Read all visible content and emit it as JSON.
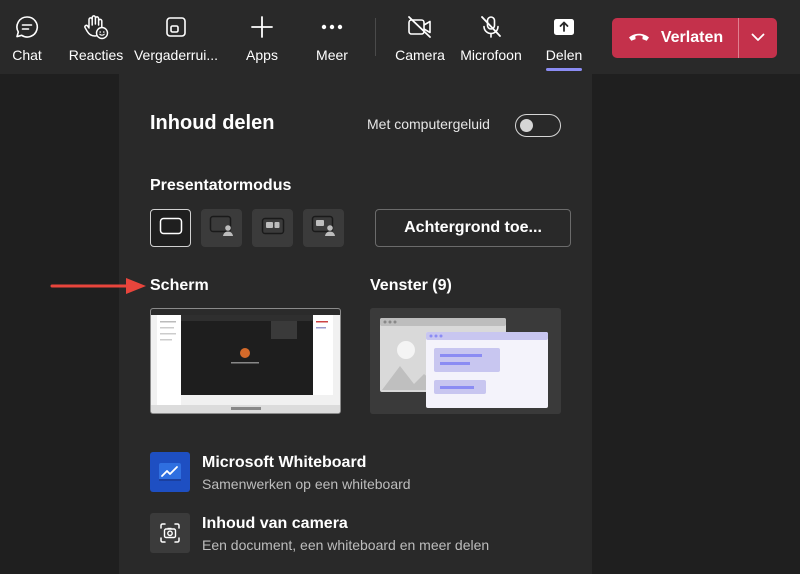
{
  "toolbar": {
    "items": [
      {
        "label": "Chat",
        "icon": "chat-icon"
      },
      {
        "label": "Reacties",
        "icon": "hand-raise-icon"
      },
      {
        "label": "Vergaderrui...",
        "icon": "rooms-icon"
      },
      {
        "label": "Apps",
        "icon": "plus-icon"
      },
      {
        "label": "Meer",
        "icon": "more-icon"
      },
      {
        "label": "Camera",
        "icon": "camera-off-icon"
      },
      {
        "label": "Microfoon",
        "icon": "mic-off-icon"
      },
      {
        "label": "Delen",
        "icon": "share-icon"
      }
    ],
    "leave_label": "Verlaten"
  },
  "panel": {
    "title": "Inhoud delen",
    "computer_audio_label": "Met computergeluid",
    "computer_audio_on": false,
    "presenter_mode_label": "Presentatormodus",
    "background_button_label": "Achtergrond toe...",
    "screen_label": "Scherm",
    "window_label": "Venster (9)",
    "options": [
      {
        "title": "Microsoft Whiteboard",
        "description": "Samenwerken op een whiteboard"
      },
      {
        "title": "Inhoud van camera",
        "description": "Een document, een whiteboard en meer delen"
      }
    ]
  },
  "colors": {
    "leave": "#c4314b",
    "accent": "#8b8cf3",
    "annotation_arrow": "#e8453c",
    "whiteboard_blue": "#1e4fc2"
  }
}
